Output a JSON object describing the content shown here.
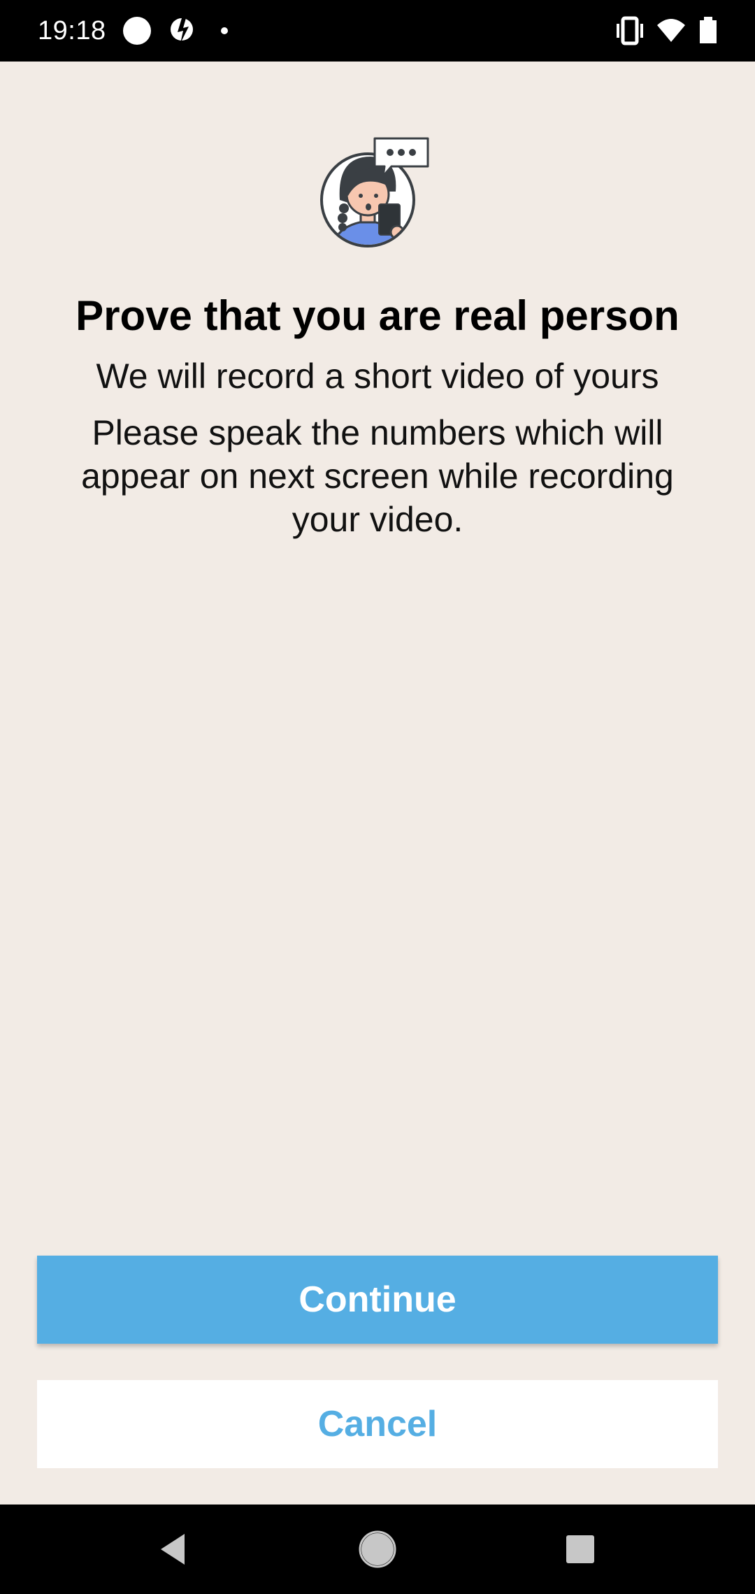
{
  "status_bar": {
    "time": "19:18",
    "icons": [
      "circle-notification-icon",
      "sync-notification-icon",
      "dot-notification-icon",
      "vibrate-icon",
      "wifi-icon",
      "battery-icon"
    ]
  },
  "main": {
    "illustration": "person-phone-speech-illustration",
    "title": "Prove that you are real person",
    "subtitle": "We will record a short video of yours",
    "instructions": "Please speak the numbers which will appear on next screen while recording your video."
  },
  "buttons": {
    "continue_label": "Continue",
    "cancel_label": "Cancel"
  },
  "nav_bar": {
    "icons": [
      "back-icon",
      "home-icon",
      "recents-icon"
    ]
  },
  "colors": {
    "background": "#f2ebe5",
    "accent": "#55aee3",
    "cancel_background": "#ffffff"
  }
}
